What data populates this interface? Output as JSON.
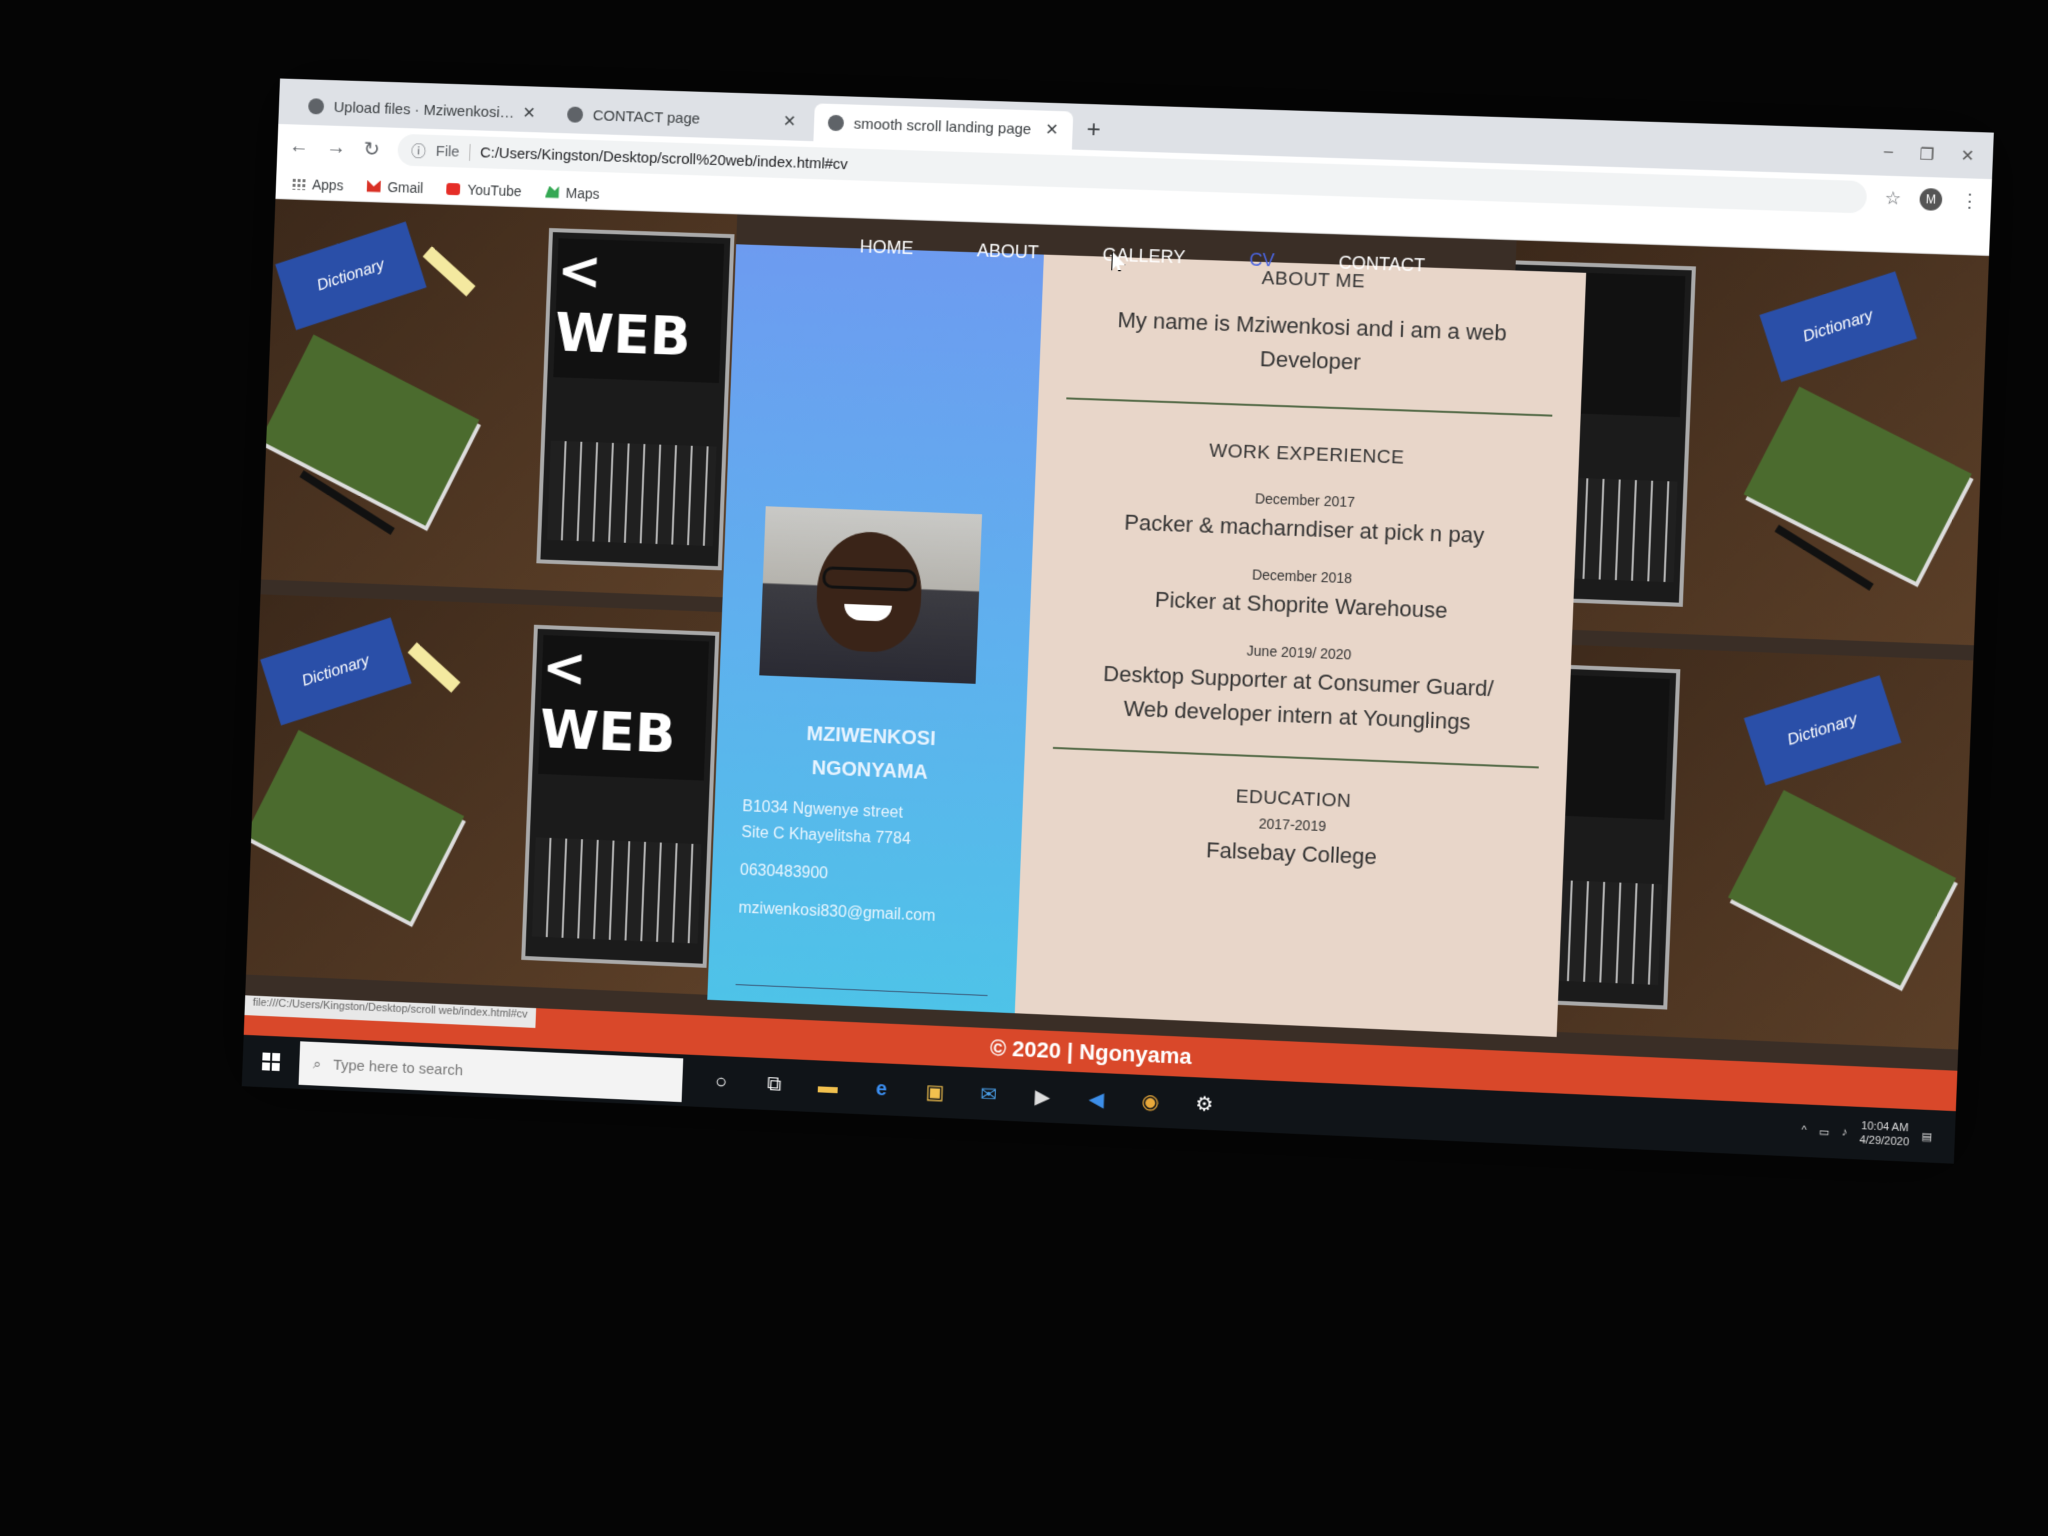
{
  "browser": {
    "tabs": [
      {
        "label": "Upload files · Mziwenkosi/march",
        "active": false
      },
      {
        "label": "CONTACT page",
        "active": false
      },
      {
        "label": "smooth scroll landing page",
        "active": true
      }
    ],
    "url_scheme": "File",
    "url": "C:/Users/Kingston/Desktop/scroll%20web/index.html#cv",
    "bookmarks": [
      "Apps",
      "Gmail",
      "YouTube",
      "Maps"
    ]
  },
  "nav": {
    "items": [
      "HOME",
      "ABOUT",
      "GALLERY",
      "CV",
      "CONTACT"
    ],
    "active": "CV"
  },
  "background": {
    "screen_text_1": "< WEB",
    "screen_text_2": ">",
    "book_label": "Dictionary"
  },
  "cv": {
    "name_line1": "MZIWENKOSI",
    "name_line2": "NGONYAMA",
    "address_line1": "B1034 Ngwenye street",
    "address_line2": "Site C Khayelitsha 7784",
    "phone": "0630483900",
    "email": "mziwenkosi830@gmail.com",
    "about_title": "ABOUT ME",
    "about_line1": "My name is Mziwenkosi and i am a web",
    "about_line2": "Developer",
    "work_title": "WORK EXPERIENCE",
    "jobs": [
      {
        "date": "December 2017",
        "line1": "Packer & macharndiser at pick n pay",
        "line2": ""
      },
      {
        "date": "December 2018",
        "line1": "Picker at Shoprite Warehouse",
        "line2": ""
      },
      {
        "date": "June 2019/ 2020",
        "line1": "Desktop Supporter at Consumer Guard/",
        "line2": "Web developer intern at Younglings"
      }
    ],
    "education_title": "EDUCATION",
    "education_years": "2017-2019",
    "education_school": "Falsebay College"
  },
  "footer": {
    "text": "© 2020 | Ngonyama",
    "status_url": "file:///C:/Users/Kingston/Desktop/scroll web/index.html#cv"
  },
  "taskbar": {
    "search_placeholder": "Type here to search",
    "time": "10:04 AM",
    "date": "4/29/2020"
  }
}
